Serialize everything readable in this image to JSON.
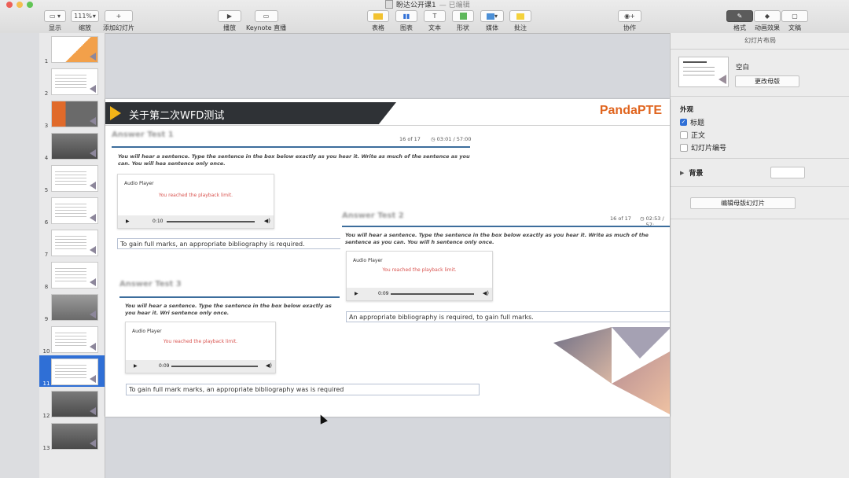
{
  "window": {
    "title": "盼达公开课1",
    "edited": "— 已编辑"
  },
  "toolbar": {
    "view": "显示",
    "zoom_value": "111%",
    "zoom": "缩放",
    "add_slide": "添加幻灯片",
    "play": "播放",
    "keynote_live": "Keynote 直播",
    "table": "表格",
    "chart": "图表",
    "text": "文本",
    "shape": "形状",
    "media": "媒体",
    "comment": "批注",
    "collaborate": "协作",
    "format": "格式",
    "animate": "动画效果",
    "document": "文稿"
  },
  "navigator": {
    "slides": [
      "1",
      "2",
      "3",
      "4",
      "5",
      "6",
      "7",
      "8",
      "9",
      "10",
      "11",
      "12",
      "13"
    ],
    "selected": "11"
  },
  "inspector": {
    "header": "幻灯片布局",
    "master_name": "空白",
    "change_master": "更改母版",
    "appearance": "外观",
    "title_opt": "标题",
    "body_opt": "正文",
    "number_opt": "幻灯片编号",
    "background": "背景",
    "edit_master": "编辑母版幻灯片"
  },
  "slide": {
    "heading": "关于第二次WFD测试",
    "logo": "PandaPTE",
    "cards": [
      {
        "blur_title": "Answer Test 1",
        "counter": "16 of 17",
        "timer": "03:01 / 57:00",
        "instruction": "You will hear a sentence. Type the sentence in the box below exactly as you hear it. Write as much of the sentence as you can. You will hea sentence only once.",
        "player_title": "Audio Player",
        "player_msg": "You reached the playback limit.",
        "player_time": "0:10",
        "answer": "To gain full marks, an appropriate bibliography is required."
      },
      {
        "blur_title": "Answer Test 2",
        "counter": "16 of 17",
        "timer": "02:53 / 57:",
        "instruction": "You will hear a sentence. Type the sentence in the box below exactly as you hear it. Write as much of the sentence as you can. You will h sentence only once.",
        "player_title": "Audio Player",
        "player_msg": "You reached the playback limit.",
        "player_time": "0:09",
        "answer": "An appropriate bibliography is required, to gain full marks."
      },
      {
        "blur_title": "Answer Test 3",
        "instruction": "You will hear a sentence. Type the sentence in the box below exactly as you hear it. Wri sentence only once.",
        "player_title": "Audio Player",
        "player_msg": "You reached the playback limit.",
        "player_time": "0:09",
        "answer": "To gain full mark marks, an appropriate bibliography was is required"
      }
    ]
  },
  "colors": {
    "accent": "#2f6fd6",
    "logo": "#e0651f",
    "banner": "#2f3236",
    "arrow": "#f2b418"
  }
}
